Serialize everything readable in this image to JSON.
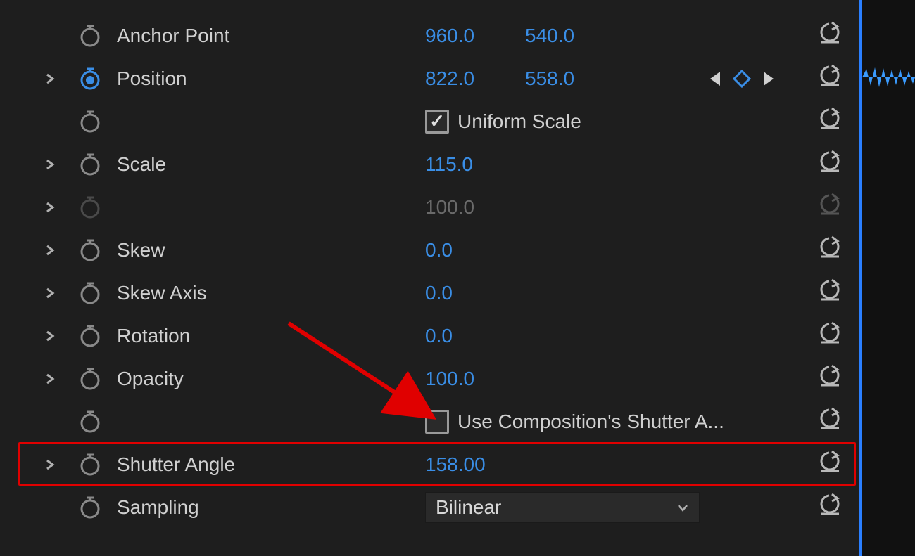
{
  "rows": {
    "anchor": {
      "label": "Anchor Point",
      "x": "960.0",
      "y": "540.0"
    },
    "position": {
      "label": "Position",
      "x": "822.0",
      "y": "558.0"
    },
    "uniform": {
      "label": "Uniform Scale"
    },
    "scale": {
      "label": "Scale",
      "v": "115.0"
    },
    "scale2": {
      "v": "100.0"
    },
    "skew": {
      "label": "Skew",
      "v": "0.0"
    },
    "skewaxis": {
      "label": "Skew Axis",
      "v": "0.0"
    },
    "rotation": {
      "label": "Rotation",
      "v": "0.0"
    },
    "opacity": {
      "label": "Opacity",
      "v": "100.0"
    },
    "compshutter": {
      "label": "Use Composition's Shutter A..."
    },
    "shutter": {
      "label": "Shutter Angle",
      "v": "158.00"
    },
    "sampling": {
      "label": "Sampling",
      "v": "Bilinear"
    }
  }
}
